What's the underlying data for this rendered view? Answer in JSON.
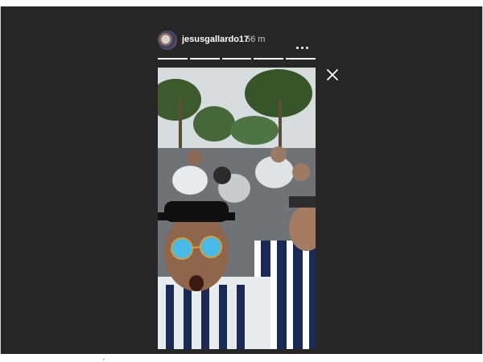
{
  "story": {
    "username": "jesusgallardo17",
    "time_ago": "56 m",
    "progress_segments": 5
  },
  "icons": {
    "more": "more-options-icon",
    "close": "close-icon"
  },
  "colors": {
    "overlay": "#262626",
    "text": "#ffffff",
    "muted_text": "#c9c9c9"
  }
}
